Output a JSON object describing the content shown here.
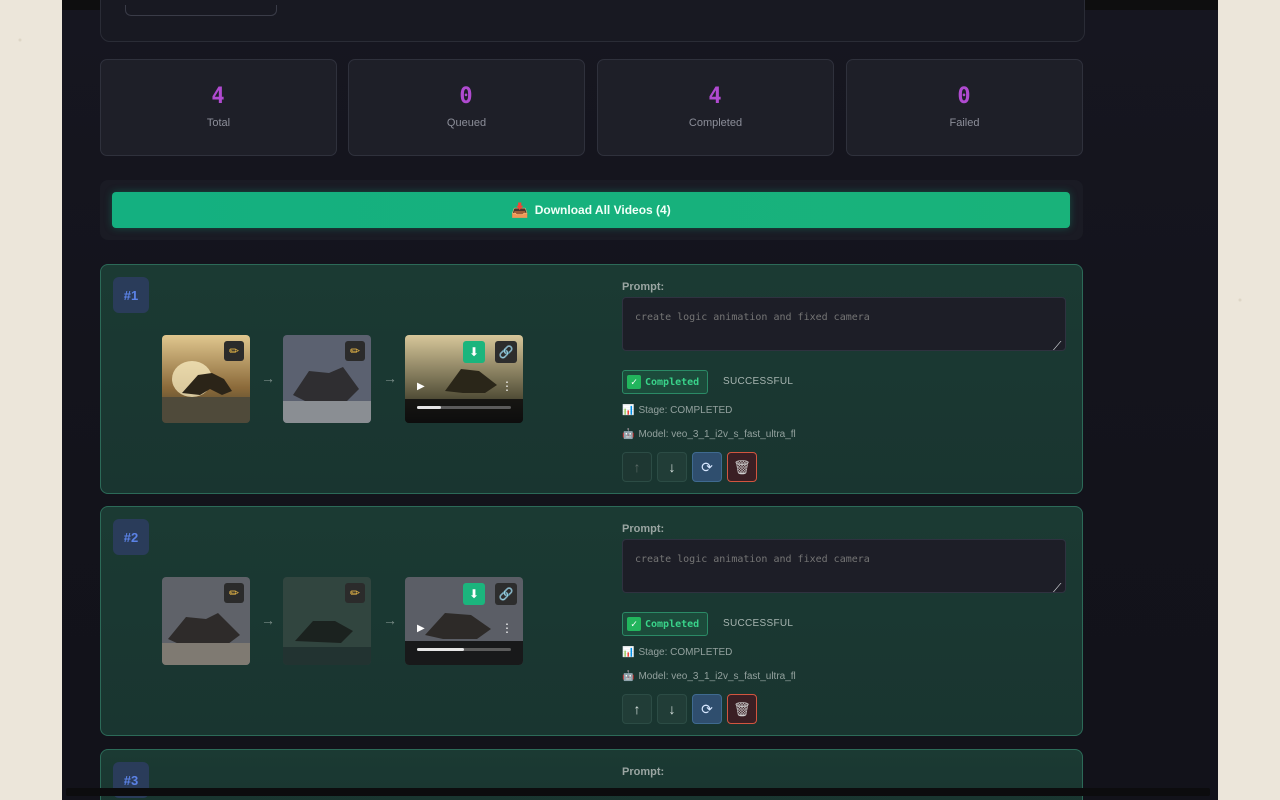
{
  "stats": [
    {
      "value": "4",
      "label": "Total"
    },
    {
      "value": "0",
      "label": "Queued"
    },
    {
      "value": "4",
      "label": "Completed"
    },
    {
      "value": "0",
      "label": "Failed"
    }
  ],
  "download_all_label": "Download All Videos (4)",
  "cards": [
    {
      "index_label": "#1",
      "prompt_label": "Prompt:",
      "prompt_placeholder": "create logic animation and fixed camera",
      "status_label": "Completed",
      "status_text": "SUCCESSFUL",
      "stage": "Stage: COMPLETED",
      "model": "Model: veo_3_1_i2v_s_fast_ultra_fl",
      "video_progress": 0.25
    },
    {
      "index_label": "#2",
      "prompt_label": "Prompt:",
      "prompt_placeholder": "create logic animation and fixed camera",
      "status_label": "Completed",
      "status_text": "SUCCESSFUL",
      "stage": "Stage: COMPLETED",
      "model": "Model: veo_3_1_i2v_s_fast_ultra_fl",
      "video_progress": 0.5
    },
    {
      "index_label": "#3",
      "prompt_label": "Prompt:"
    }
  ],
  "icons": {
    "download_all": "inbox-tray-icon",
    "edit": "pencil-icon",
    "video_download": "download-icon",
    "video_link": "link-icon",
    "status_check": "check-box-icon",
    "stage": "bar-chart-icon",
    "model": "robot-icon",
    "move_up": "arrow-up-icon",
    "move_down": "arrow-down-icon",
    "retry": "refresh-icon",
    "delete": "trash-icon"
  }
}
